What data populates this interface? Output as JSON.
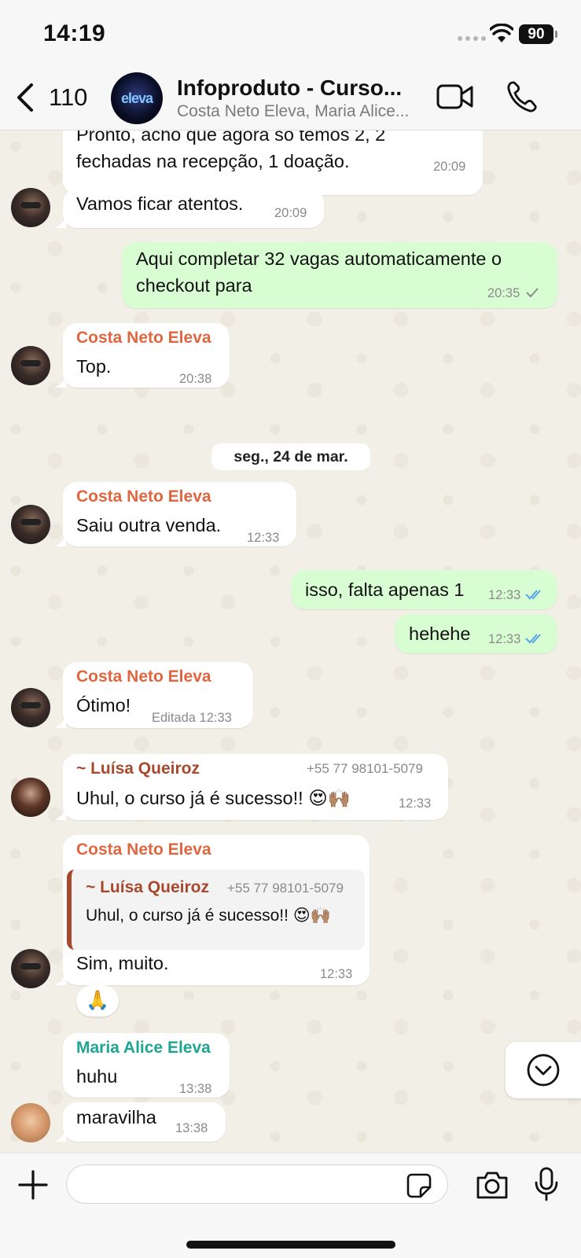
{
  "status": {
    "time": "14:19",
    "battery": "90"
  },
  "header": {
    "back_count": "110",
    "title": "Infoproduto - Curso...",
    "subtitle": "Costa Neto Eleva, Maria Alice..."
  },
  "messages": [
    {
      "text1": "Pronto, acho que agora só temos 2, 2",
      "text2": "fechadas na recepção, 1 doação.",
      "time": "20:09"
    },
    {
      "text": "Vamos ficar atentos.",
      "time": "20:09"
    },
    {
      "text1": "Aqui completar 32 vagas automaticamente o",
      "text2": "checkout para",
      "time": "20:35"
    },
    {
      "sender": "Costa Neto Eleva",
      "text": "Top.",
      "time": "20:38"
    },
    {
      "sender": "Costa Neto Eleva",
      "text": "Saiu outra venda.",
      "time": "12:33"
    },
    {
      "text": "isso, falta apenas 1",
      "time": "12:33"
    },
    {
      "text": "hehehe",
      "time": "12:33"
    },
    {
      "sender": "Costa Neto Eleva",
      "text": "Ótimo!",
      "time": "Editada 12:33"
    },
    {
      "sender": "~ Luísa Queiroz",
      "phone": "+55 77 98101-5079",
      "text": "Uhul, o curso já é sucesso!!",
      "emoji": "😍🙌🏽",
      "time": "12:33"
    },
    {
      "sender": "Costa Neto Eleva",
      "quote": {
        "sender": "~ Luísa Queiroz",
        "phone": "+55 77 98101-5079",
        "text": "Uhul, o curso já é sucesso!!",
        "emoji": "😍🙌🏽"
      },
      "text": "Sim, muito.",
      "time": "12:33",
      "reaction": "🙏"
    },
    {
      "sender": "Maria Alice Eleva",
      "text": "huhu",
      "time": "13:38"
    },
    {
      "text": "maravilha",
      "time": "13:38"
    }
  ],
  "date_separator": "seg., 24 de mar.",
  "input": {
    "placeholder": ""
  },
  "colors": {
    "costa": "#e0663f",
    "luisa": "#a6492c",
    "maria": "#1fa593",
    "outgoing_bubble": "#d9fdd3",
    "read_ticks": "#53a6e6"
  }
}
